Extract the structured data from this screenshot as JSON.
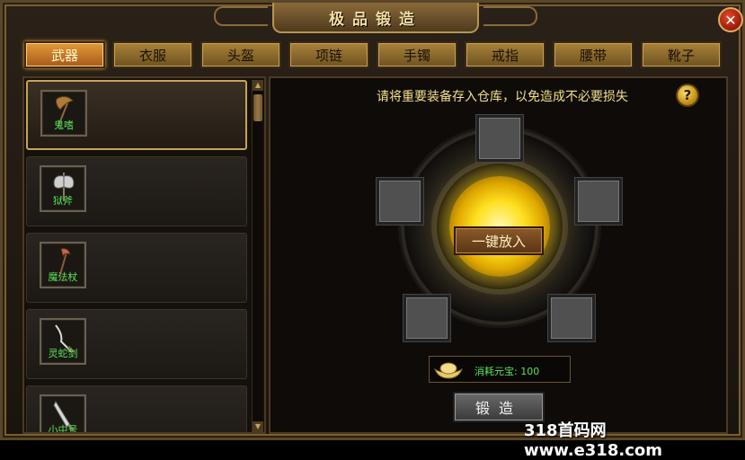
{
  "window": {
    "title": "极品锻造",
    "close_icon": "close-icon"
  },
  "tabs": [
    {
      "label": "武器",
      "active": true
    },
    {
      "label": "衣服",
      "active": false
    },
    {
      "label": "头盔",
      "active": false
    },
    {
      "label": "项链",
      "active": false
    },
    {
      "label": "手镯",
      "active": false
    },
    {
      "label": "戒指",
      "active": false
    },
    {
      "label": "腰带",
      "active": false
    },
    {
      "label": "靴子",
      "active": false
    }
  ],
  "item_list": {
    "items": [
      {
        "name": "鬼嗜",
        "icon": "axe-icon",
        "selected": true
      },
      {
        "name": "狱斧",
        "icon": "battle-axe-icon",
        "selected": false
      },
      {
        "name": "魔法杖",
        "icon": "staff-icon",
        "selected": false
      },
      {
        "name": "灵蛇剑",
        "icon": "sword-icon",
        "selected": false
      },
      {
        "name": "小中号",
        "icon": "blade-icon",
        "selected": false
      }
    ]
  },
  "forge": {
    "hint": "请将重要装备存入仓库，以免造成不必要损失",
    "help_label": "?",
    "put_all_label": "一键放入",
    "cost_label": "消耗元宝: 100",
    "forge_label": "锻造"
  },
  "watermark": "318首码网 www.e318.com",
  "colors": {
    "accent": "#e09a38",
    "item_name": "#58e258",
    "hint": "#f2e08a"
  }
}
